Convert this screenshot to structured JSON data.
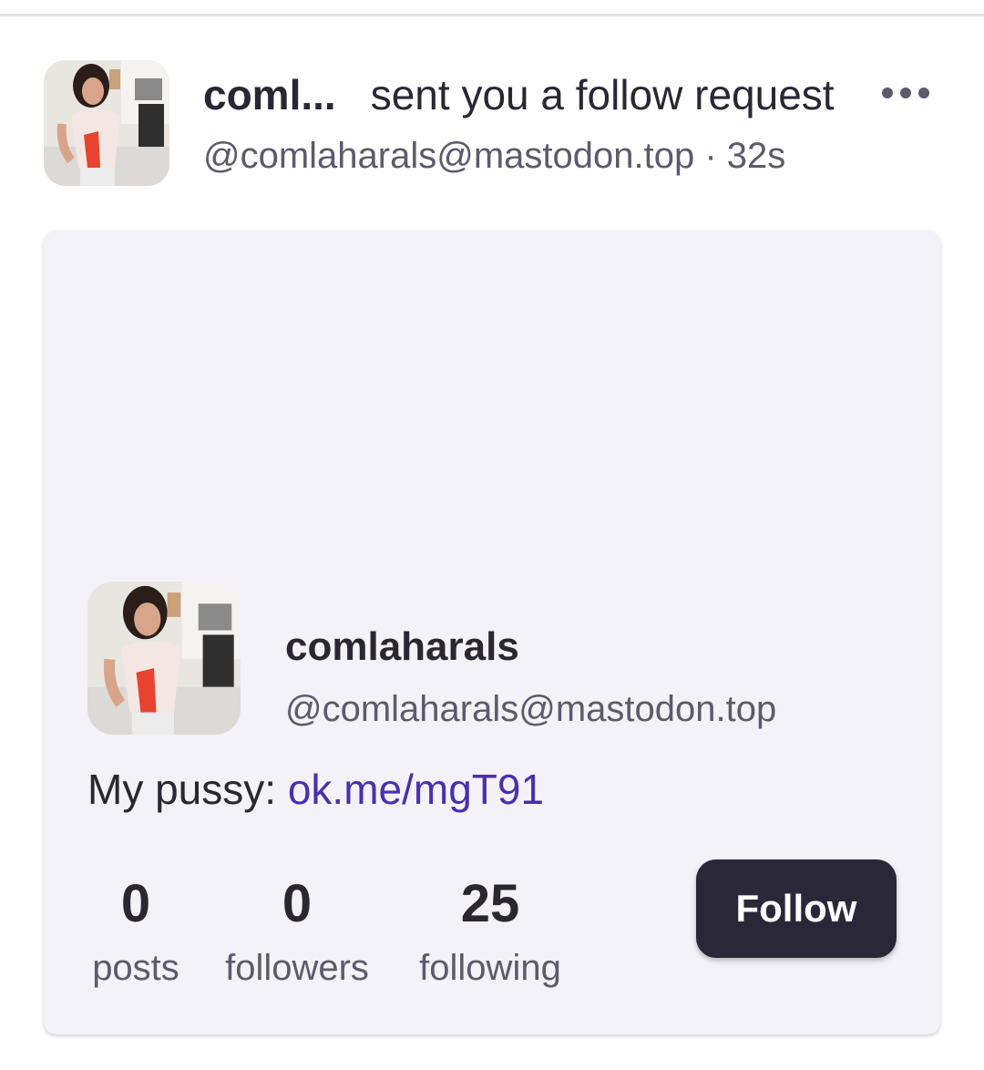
{
  "notification": {
    "display_name_truncated": "coml...",
    "action_text": "sent you a follow request",
    "handle": "@comlaharals@mastodon.top",
    "separator": " · ",
    "time_ago": "32s",
    "more_icon": "more-horizontal-icon"
  },
  "card": {
    "display_name": "comlaharals",
    "handle": "@comlaharals@mastodon.top",
    "bio_prefix": "My pussy: ",
    "bio_link": "ok.me/mgT91",
    "stats": [
      {
        "value": "0",
        "label": "posts"
      },
      {
        "value": "0",
        "label": "followers"
      },
      {
        "value": "25",
        "label": "following"
      }
    ],
    "follow_button_label": "Follow"
  },
  "colors": {
    "accent_link": "#4a2fb0",
    "button_bg": "#2a2838",
    "card_bg": "#f3f2f8",
    "secondary_text": "#5d5a6c"
  }
}
